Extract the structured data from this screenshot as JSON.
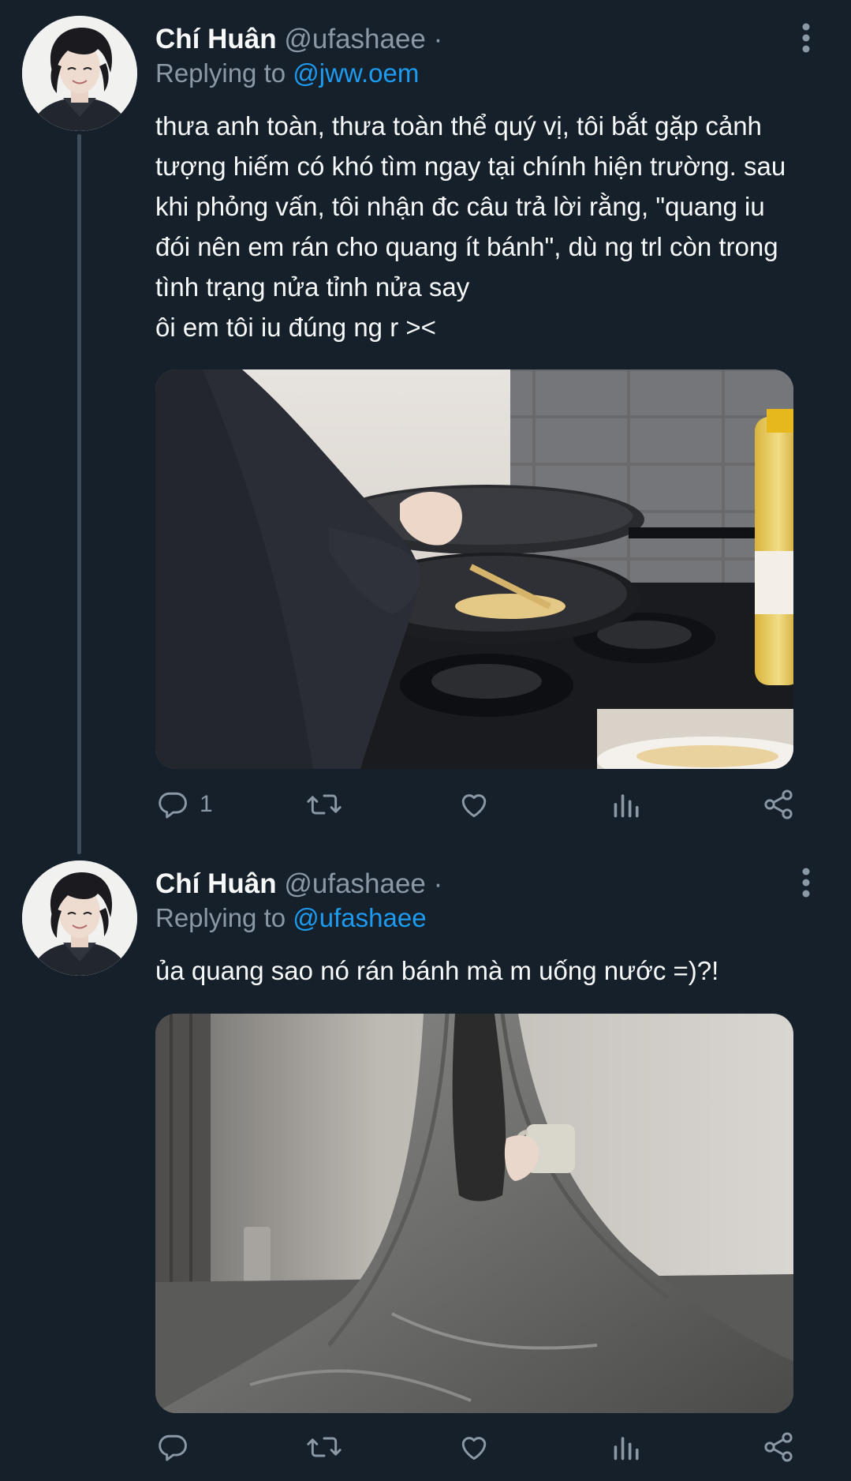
{
  "tweets": [
    {
      "author": {
        "name": "Chí Huân",
        "handle": "@ufashaee",
        "separator": "·"
      },
      "replying_to": {
        "label": "Replying to",
        "mention": "@jww.oem"
      },
      "text_lines": [
        "thưa anh toàn, thưa toàn thể quý vị, tôi bắt gặp cảnh",
        "tượng hiếm có khó tìm ngay tại chính hiện trường. sau",
        "khi phỏng vấn, tôi nhận đc câu trả lời rằng, \"quang iu",
        "đói nên em rán cho quang ít bánh\", dù ng trl còn trong",
        "tình trạng nửa tỉnh nửa say",
        "ôi em tôi iu đúng ng r ><"
      ],
      "actions": {
        "reply_count": "1",
        "retweet_count": "",
        "like_count": ""
      },
      "icons": [
        "more-options-icon",
        "reply-icon",
        "retweet-icon",
        "like-icon",
        "views-icon",
        "share-icon"
      ]
    },
    {
      "author": {
        "name": "Chí Huân",
        "handle": "@ufashaee",
        "separator": "·"
      },
      "replying_to": {
        "label": "Replying to",
        "mention": "@ufashaee"
      },
      "text_lines": [
        "ủa quang sao nó rán bánh mà m uống nước =)?!"
      ],
      "actions": {
        "reply_count": "",
        "retweet_count": "",
        "like_count": ""
      },
      "icons": [
        "more-options-icon",
        "reply-icon",
        "retweet-icon",
        "like-icon",
        "views-icon",
        "share-icon"
      ]
    }
  ],
  "colors": {
    "background": "#15202b",
    "text_primary": "#f7f9f9",
    "text_secondary": "#8b98a5",
    "link": "#1d9bf0",
    "thread_line": "#3d4d5c"
  }
}
